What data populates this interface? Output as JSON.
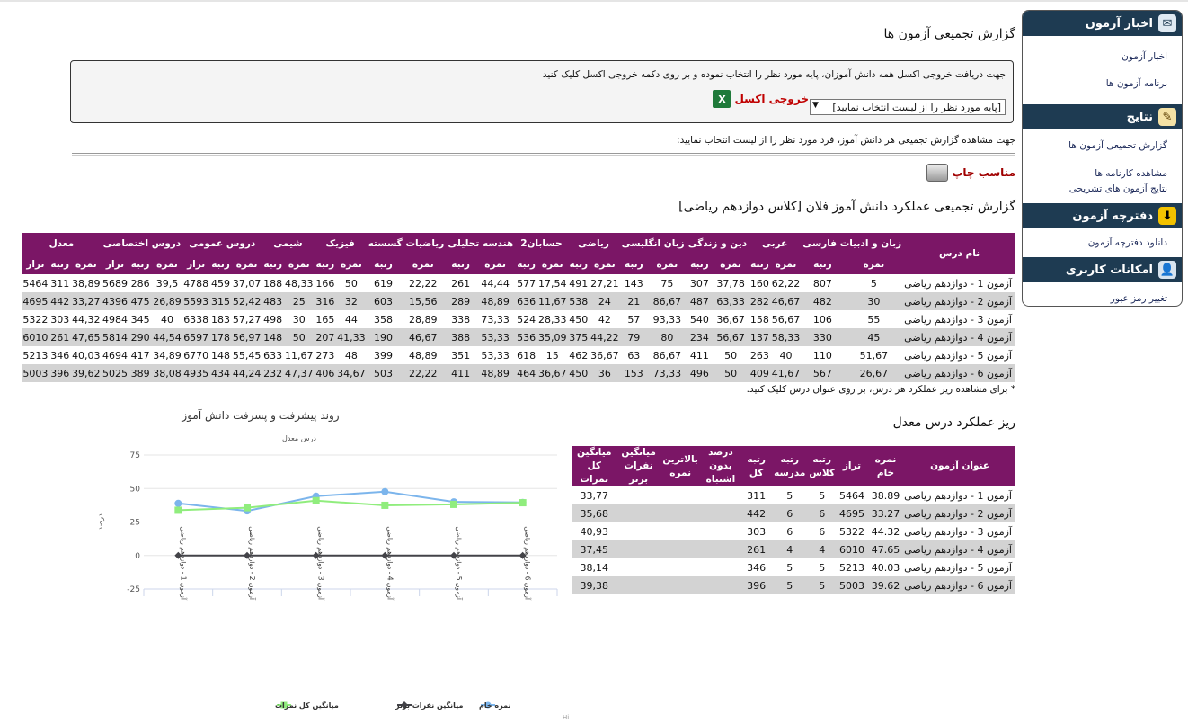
{
  "sidebar": {
    "sections": [
      {
        "title": "اخبار آزمون",
        "items": [
          "اخبار آزمون",
          "برنامه آزمون ها"
        ]
      },
      {
        "title": "نتایج",
        "items": [
          "گزارش تجمیعی آزمون ها",
          "مشاهده کارنامه ها",
          "نتایج آزمون های تشریحی"
        ]
      },
      {
        "title": "دفترچه آزمون",
        "items": [
          "دانلود دفترچه آزمون"
        ]
      },
      {
        "title": "امکانات کاربری",
        "items": [
          "تغییر رمز عبور"
        ]
      }
    ],
    "colors": {
      "header": "#1e3b52"
    }
  },
  "page": {
    "title": "گزارش تجمیعی آزمون ها",
    "excel_instructions": "جهت دریافت خروجی اکسل همه دانش آموزان، پایه مورد نظر را انتخاب نموده و بر روی دکمه خروجی اکسل کلیک کنید",
    "excel_button": "خروجی اکسل",
    "grade_select": "[پایه مورد نظر را از لیست انتخاب نمایید]",
    "student_note": "جهت مشاهده گزارش تجمیعی هر دانش آموز، فرد مورد نظر را از لیست انتخاب نمایید:",
    "print_label": "مناسب چاپ",
    "report_title": "گزارش تجمیعی عملکرد دانش آموز فلان [کلاس دوازدهم ریاضی]",
    "footnote": "* برای مشاهده ریز عملکرد هر درس، بر روی عنوان درس کلیک کنید.",
    "detail_title": "ریز عملکرد درس معدل"
  },
  "big_table": {
    "name_header": "نام درس",
    "groups": [
      "زبان و ادبیات فارسی",
      "عربی",
      "دین و زندگی",
      "زبان انگلیسی",
      "ریاضی",
      "حسابان2",
      "هندسه تحلیلی",
      "ریاضیات گسسته",
      "فیزیک",
      "شیمی",
      "دروس عمومی",
      "دروس اختصاصی",
      "معدل"
    ],
    "sub_headers": {
      "nomre": "نمره",
      "rotbe": "رتبه",
      "taraz": "تراز"
    },
    "rows": [
      {
        "name": "آزمون 1 - دوازدهم ریاضی",
        "v": [
          "5",
          "807",
          "62,22",
          "160",
          "37,78",
          "307",
          "75",
          "143",
          "27,21",
          "491",
          "17,54",
          "577",
          "44,44",
          "261",
          "22,22",
          "619",
          "50",
          "166",
          "48,33",
          "188",
          "37,07",
          "459",
          "4788",
          "39,5",
          "286",
          "5689",
          "38,89",
          "311",
          "5464"
        ]
      },
      {
        "name": "آزمون 2 - دوازدهم ریاضی",
        "v": [
          "30",
          "482",
          "46,67",
          "282",
          "63,33",
          "487",
          "86,67",
          "21",
          "24",
          "538",
          "11,67",
          "636",
          "48,89",
          "289",
          "15,56",
          "603",
          "32",
          "316",
          "25",
          "483",
          "52,42",
          "315",
          "5593",
          "26,89",
          "475",
          "4396",
          "33,27",
          "442",
          "4695"
        ]
      },
      {
        "name": "آزمون 3 - دوازدهم ریاضی",
        "v": [
          "55",
          "106",
          "56,67",
          "158",
          "36,67",
          "540",
          "93,33",
          "57",
          "42",
          "450",
          "28,33",
          "524",
          "73,33",
          "338",
          "28,89",
          "358",
          "44",
          "165",
          "30",
          "498",
          "57,27",
          "183",
          "6338",
          "40",
          "345",
          "4984",
          "44,32",
          "303",
          "5322"
        ]
      },
      {
        "name": "آزمون 4 - دوازدهم ریاضی",
        "v": [
          "45",
          "330",
          "58,33",
          "137",
          "56,67",
          "234",
          "80",
          "79",
          "44,22",
          "375",
          "35,09",
          "536",
          "53,33",
          "388",
          "46,67",
          "190",
          "41,33",
          "207",
          "50",
          "148",
          "56,97",
          "178",
          "6597",
          "44,54",
          "290",
          "5814",
          "47,65",
          "261",
          "6010"
        ]
      },
      {
        "name": "آزمون 5 - دوازدهم ریاضی",
        "v": [
          "51,67",
          "110",
          "40",
          "263",
          "50",
          "411",
          "86,67",
          "63",
          "36,67",
          "462",
          "15",
          "618",
          "53,33",
          "351",
          "48,89",
          "399",
          "48",
          "273",
          "11,67",
          "633",
          "55,45",
          "148",
          "6770",
          "34,89",
          "417",
          "4694",
          "40,03",
          "346",
          "5213"
        ]
      },
      {
        "name": "آزمون 6 - دوازدهم ریاضی",
        "v": [
          "26,67",
          "567",
          "41,67",
          "409",
          "50",
          "496",
          "73,33",
          "153",
          "36",
          "450",
          "36,67",
          "464",
          "48,89",
          "411",
          "22,22",
          "503",
          "34,67",
          "406",
          "47,37",
          "232",
          "44,24",
          "434",
          "4935",
          "38,08",
          "389",
          "5025",
          "39,62",
          "396",
          "5003"
        ]
      }
    ]
  },
  "small_table": {
    "headers": [
      "عنوان آزمون",
      "نمره خام",
      "تراز",
      "رتبه کلاس",
      "رتبه مدرسه",
      "رتبه کل",
      "درصد بدون اشتباه",
      "بالاترین نمره",
      "میانگین نفرات برتر",
      "میانگین کل نمرات"
    ],
    "rows": [
      [
        "آزمون 1 - دوازدهم ریاضی",
        "38.89",
        "5464",
        "5",
        "5",
        "311",
        "",
        "",
        "",
        "33,77"
      ],
      [
        "آزمون 2 - دوازدهم ریاضی",
        "33.27",
        "4695",
        "6",
        "6",
        "442",
        "",
        "",
        "",
        "35,68"
      ],
      [
        "آزمون 3 - دوازدهم ریاضی",
        "44.32",
        "5322",
        "6",
        "6",
        "303",
        "",
        "",
        "",
        "40,93"
      ],
      [
        "آزمون 4 - دوازدهم ریاضی",
        "47.65",
        "6010",
        "4",
        "4",
        "261",
        "",
        "",
        "",
        "37,45"
      ],
      [
        "آزمون 5 - دوازدهم ریاضی",
        "40.03",
        "5213",
        "5",
        "5",
        "346",
        "",
        "",
        "",
        "38,14"
      ],
      [
        "آزمون 6 - دوازدهم ریاضی",
        "39.62",
        "5003",
        "5",
        "5",
        "396",
        "",
        "",
        "",
        "39,38"
      ]
    ]
  },
  "chart_data": {
    "type": "line",
    "title": "روند پیشرفت و پسرفت دانش آموز",
    "subtitle": "درس معدل",
    "ylabel": "درصد",
    "ylim": [
      -25,
      75
    ],
    "yticks": [
      "75",
      "50",
      "25",
      "0",
      "-25"
    ],
    "categories": [
      "آزمون 1 - دوازدهم ریاضی",
      "آزمون 2 - دوازدهم ریاضی",
      "آزمون 3 - دوازدهم ریاضی",
      "آزمون 4 - دوازدهم ریاضی",
      "آزمون 5 - دوازدهم ریاضی",
      "آزمون 6 - دوازدهم ریاضی"
    ],
    "series": [
      {
        "name": "نمره خام",
        "color": "#7cb5ec",
        "marker": "circle",
        "values": [
          38.89,
          33.27,
          44.32,
          47.65,
          40.03,
          39.62
        ]
      },
      {
        "name": "میانگین نفرات برتر",
        "color": "#434348",
        "marker": "diamond",
        "values": [
          0,
          0,
          0,
          0,
          0,
          0
        ]
      },
      {
        "name": "میانگین کل نمرات",
        "color": "#90ed7d",
        "marker": "square",
        "values": [
          33.77,
          35.68,
          40.93,
          37.45,
          38.14,
          39.38
        ]
      }
    ],
    "credit": "Hi"
  }
}
